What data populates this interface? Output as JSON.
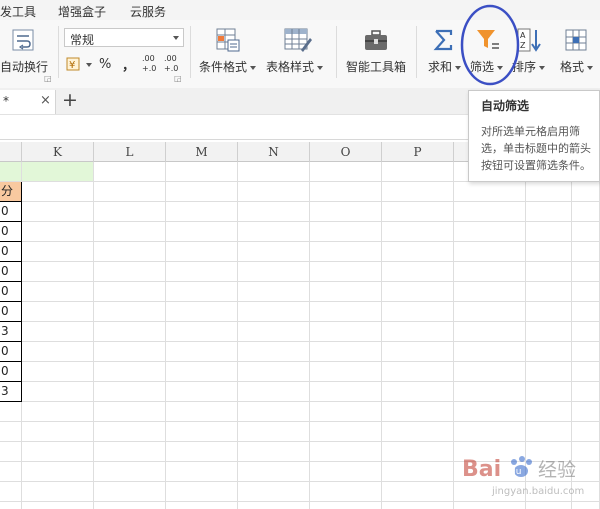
{
  "menu": [
    "发工具",
    "增强盒子",
    "云服务"
  ],
  "ribbon": {
    "auto_wrap": "自动换行",
    "number_format": "常规",
    "percent": "%",
    "comma": "，",
    "inc_decimal_top": ".00",
    "inc_decimal_bottom": "+.0",
    "dec_decimal_top": ".00",
    "dec_decimal_bottom": "+.0",
    "conditional_format": "条件格式",
    "table_style": "表格样式",
    "smart_toolbox": "智能工具箱",
    "sum": "求和",
    "filter": "筛选",
    "sort": "排序",
    "format": "格式"
  },
  "tooltip": {
    "title": "自动筛选",
    "lines": [
      "对所选单元格启用筛",
      "选，单击标题中的箭头",
      "按钮可设置筛选条件。"
    ]
  },
  "tabs": {
    "doc_name": "*",
    "close": "×",
    "add": "+"
  },
  "columns": [
    "K",
    "L",
    "M",
    "N",
    "O",
    "P",
    "",
    "",
    ""
  ],
  "column_a_cells": [
    "",
    "分",
    "0",
    "0",
    "0",
    "0",
    "0",
    "0",
    "3",
    "0",
    "0",
    "3"
  ],
  "colors": {
    "highlight_header_green": "#e2f7d8",
    "highlight_header_orange": "#f8c9a0",
    "annotation_circle": "#3b4fc4",
    "filter_icon": "#f0932d"
  },
  "watermark": {
    "brand": "Bai",
    "paw": "du",
    "cn": "经验",
    "sub": "jingyan.baidu.com"
  }
}
